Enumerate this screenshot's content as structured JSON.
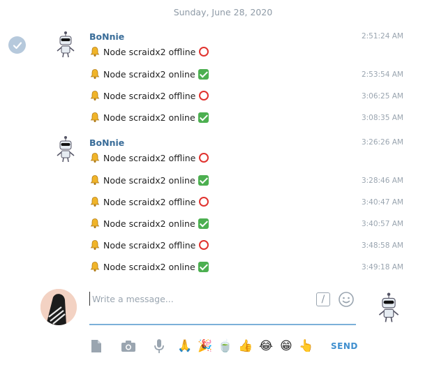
{
  "date_separator": "Sunday, June 28, 2020",
  "groups": [
    {
      "sender": "BoNnie",
      "messages": [
        {
          "text": "Node scraidx2 offline",
          "status": "offline",
          "time": "2:51:24 AM"
        },
        {
          "text": "Node scraidx2 online",
          "status": "online",
          "time": "2:53:54 AM"
        },
        {
          "text": "Node scraidx2 offline",
          "status": "offline",
          "time": "3:06:25 AM"
        },
        {
          "text": "Node scraidx2 online",
          "status": "online",
          "time": "3:08:35 AM"
        }
      ]
    },
    {
      "sender": "BoNnie",
      "messages": [
        {
          "text": "Node scraidx2 offline",
          "status": "offline",
          "time": "3:26:26 AM"
        },
        {
          "text": "Node scraidx2 online",
          "status": "online",
          "time": "3:28:46 AM"
        },
        {
          "text": "Node scraidx2 offline",
          "status": "offline",
          "time": "3:40:47 AM"
        },
        {
          "text": "Node scraidx2 online",
          "status": "online",
          "time": "3:40:57 AM"
        },
        {
          "text": "Node scraidx2 offline",
          "status": "offline",
          "time": "3:48:58 AM"
        },
        {
          "text": "Node scraidx2 online",
          "status": "online",
          "time": "3:49:18 AM"
        }
      ]
    }
  ],
  "composer": {
    "placeholder": "Write a message...",
    "commands_label": "/",
    "send_label": "SEND"
  },
  "toolbar_emojis": [
    "🙏",
    "🎉",
    "🍵",
    "👍",
    "😂",
    "😁",
    "👆"
  ],
  "colors": {
    "accent": "#3f8fcf",
    "sender": "#3a6d99",
    "time": "#9aa5b0",
    "offline": "#e0322e",
    "online": "#4caf50"
  }
}
